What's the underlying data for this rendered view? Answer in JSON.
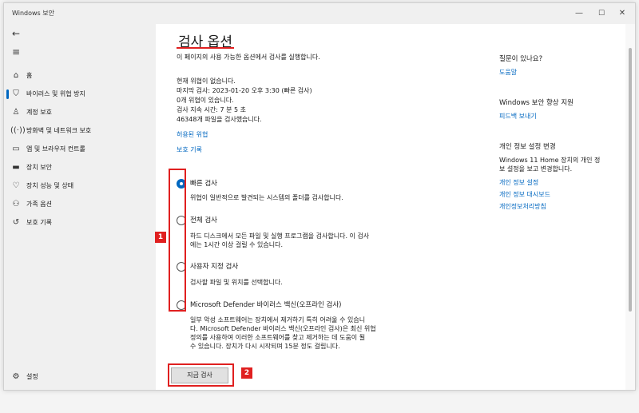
{
  "window": {
    "title": "Windows 보안"
  },
  "sidebar": {
    "items": [
      {
        "label": "홈",
        "icon": "home-icon"
      },
      {
        "label": "바이러스 및 위협 방지",
        "icon": "shield-icon"
      },
      {
        "label": "계정 보호",
        "icon": "person-icon"
      },
      {
        "label": "방화벽 및 네트워크 보호",
        "icon": "wifi-icon"
      },
      {
        "label": "앱 및 브라우저 컨트롤",
        "icon": "app-window-icon"
      },
      {
        "label": "장치 보안",
        "icon": "laptop-icon"
      },
      {
        "label": "장치 성능 및 상태",
        "icon": "heart-icon"
      },
      {
        "label": "가족 옵션",
        "icon": "family-icon"
      },
      {
        "label": "보호 기록",
        "icon": "history-icon"
      }
    ],
    "settings_label": "설정"
  },
  "main": {
    "title": "검사 옵션",
    "subtitle": "이 페이지의 사용 가능한 옵션에서 검사를 실행합니다.",
    "status": {
      "line1": "현재 위협이 없습니다.",
      "line2": "마지막 검사: 2023-01-20 오후 3:30 (빠른 검사)",
      "line3": "0개 위협이 있습니다.",
      "line4": "검사 지속 시간: 7 분 5 초",
      "line5": "46348개 파일을 검사했습니다."
    },
    "link_allowed": "허용된 위협",
    "link_history": "보호 기록",
    "options": [
      {
        "label": "빠른 검사",
        "desc": [
          "위협이 일반적으로 발견되는 시스템의 폴더를 검사합니다."
        ],
        "selected": true
      },
      {
        "label": "전체 검사",
        "desc": [
          "하드 디스크에서 모든 파일 및 실행 프로그램을 검사합니다. 이 검사",
          "에는 1시간 이상 걸릴 수 있습니다."
        ],
        "selected": false
      },
      {
        "label": "사용자 지정 검사",
        "desc": [
          "검사할 파일 및 위치를 선택합니다."
        ],
        "selected": false
      },
      {
        "label": "Microsoft Defender 바이러스 백신(오프라인 검사)",
        "desc": [
          "일부 악성 소프트웨어는 장치에서 제거하기 특히 어려울 수 있습니",
          "다. Microsoft Defender 바이러스 백신(오프라인 검사)은 최신 위협",
          "정의를 사용하여 이러한 소프트웨어를 찾고 제거하는 데 도움이 될",
          "수 있습니다. 장치가 다시 시작되며 15분 정도 걸립니다."
        ],
        "selected": false
      }
    ],
    "scan_button": "지금 검사",
    "badges": {
      "b1": "1",
      "b2": "2"
    }
  },
  "right": {
    "help_heading": "질문이 있나요?",
    "help_link": "도움말",
    "improve_heading": "Windows 보안 향상 지원",
    "improve_link": "피드백 보내기",
    "privacy_heading": "개인 정보 설정 변경",
    "privacy_desc1": "Windows 11 Home 장치의 개인 정",
    "privacy_desc2": "보 설정을 보고 변경합니다.",
    "privacy_links": [
      "개인 정보 설정",
      "개인 정보 대시보드",
      "개인정보처리방침"
    ]
  },
  "colors": {
    "accent": "#0067c0",
    "highlight": "#e02020"
  }
}
